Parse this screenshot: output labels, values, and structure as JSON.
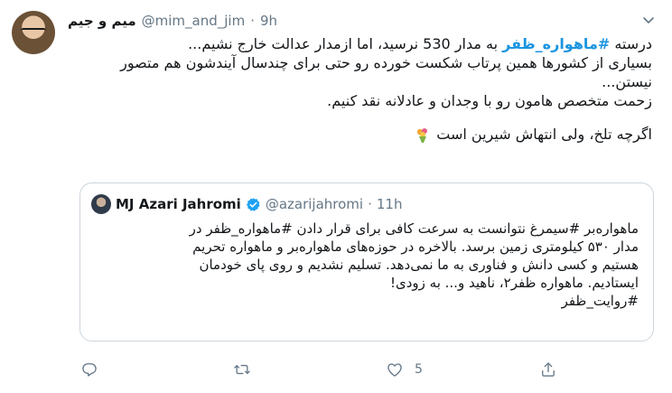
{
  "tweet": {
    "display_name": "میم و جیم",
    "handle": "@mim_and_jim",
    "separator": "·",
    "time": "9h",
    "lines": {
      "l1_before": "درسته ",
      "l1_hashtag": "#ماهواره_ظفر",
      "l1_after": " به مدار 530 نرسید، اما ازمدار عدالت خارج نشیم...",
      "l2": "بسیاری از کشورها همین پرتاب شکست خورده رو حتی برای چندسال آیندشون هم متصور نیستن...",
      "l3": "زحمت متخصص هامون رو با وجدان و عادلانه نقد کنیم.",
      "l4": "اگرچه تلخ، ولی انتهاش شیرین است"
    },
    "emoji_icon": "bouquet-icon"
  },
  "quote": {
    "display_name": "MJ Azari Jahromi",
    "handle": "@azarijahromi",
    "separator": "·",
    "time": "11h",
    "verified_icon": "verified-badge-icon",
    "lines": [
      "ماهواره‌بر #سیمرغ نتوانست به سرعت کافی برای قرار دادن #ماهواره_ظفر در",
      "مدار ۵۳۰ کیلومتری زمین برسد. بالاخره در حوزه‌های ماهواره‌بر و ماهواره تحریم",
      "هستیم و کسی دانش و فناوری به ما نمی‌دهد. تسلیم نشدیم و روی پای خودمان",
      "ایستادیم. ماهواره ظفر۲، ناهید و... به زودی!",
      "#روایت_ظفر"
    ]
  },
  "actions": {
    "reply_icon": "reply-icon",
    "retweet_icon": "retweet-icon",
    "like_icon": "like-icon",
    "like_count": "5",
    "share_icon": "share-icon"
  },
  "colors": {
    "accent": "#1b95e0",
    "muted": "#657786",
    "border": "#ccd6dd",
    "text": "#14171a"
  }
}
